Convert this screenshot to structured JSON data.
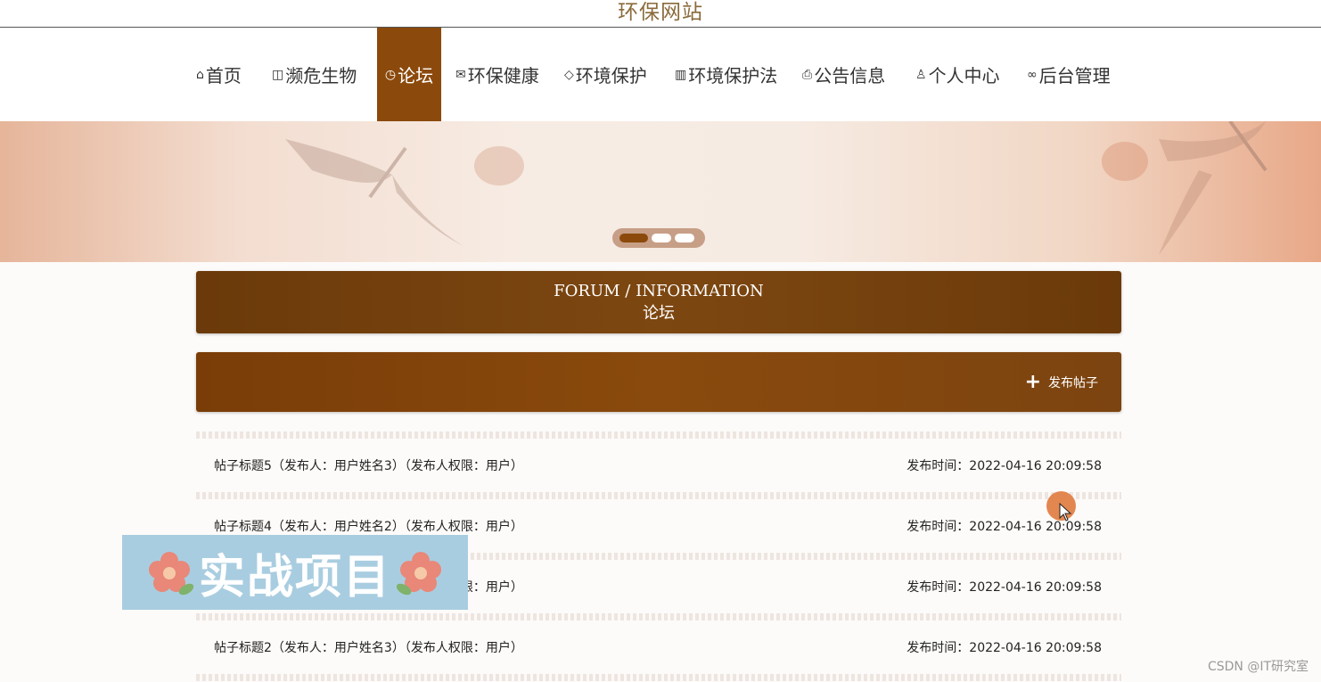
{
  "site": {
    "title": "环保网站"
  },
  "nav": {
    "items": [
      {
        "label": "首页",
        "icon": "home-icon"
      },
      {
        "label": "濒危生物",
        "icon": "binoculars-icon"
      },
      {
        "label": "论坛",
        "icon": "clock-icon",
        "active": true
      },
      {
        "label": "环保健康",
        "icon": "mail-icon"
      },
      {
        "label": "环境保护",
        "icon": "tag-icon"
      },
      {
        "label": "环境保护法",
        "icon": "building-icon"
      },
      {
        "label": "公告信息",
        "icon": "printer-icon"
      },
      {
        "label": "个人中心",
        "icon": "user-icon"
      },
      {
        "label": "后台管理",
        "icon": "link-icon"
      }
    ]
  },
  "banner": {
    "slides": 3,
    "active_slide": 1
  },
  "forum": {
    "heading_en": "FORUM / INFORMATION",
    "heading_zh": "论坛",
    "post_button_label": "发布帖子",
    "posts": [
      {
        "title": "帖子标题5（发布人：用户姓名3）（发布人权限：用户）",
        "time": "发布时间：2022-04-16 20:09:58"
      },
      {
        "title": "帖子标题4（发布人：用户姓名2）（发布人权限：用户）",
        "time": "发布时间：2022-04-16 20:09:58"
      },
      {
        "title": "帖子标题3（发布人：用户姓名1）（发布人权限：用户）",
        "time": "发布时间：2022-04-16 20:09:58"
      },
      {
        "title": "帖子标题2（发布人：用户姓名3）（发布人权限：用户）",
        "time": "发布时间：2022-04-16 20:09:58"
      }
    ]
  },
  "overlay": {
    "label": "实战项目"
  },
  "watermark": "CSDN @IT研究室",
  "colors": {
    "accent": "#8b4a0c",
    "overlay_bg": "#a9cde0",
    "cursor": "#e07a3e"
  }
}
